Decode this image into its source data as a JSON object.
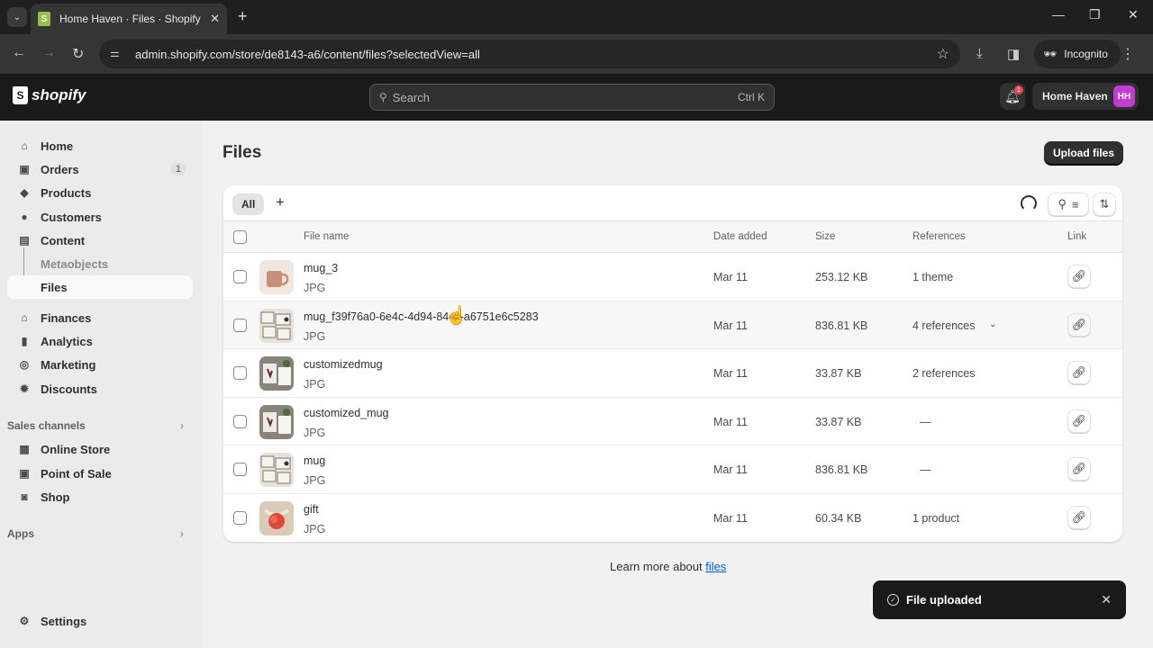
{
  "browser": {
    "tab_title": "Home Haven · Files · Shopify",
    "url": "admin.shopify.com/store/de8143-a6/content/files?selectedView=all",
    "incognito_label": "Incognito"
  },
  "topbar": {
    "logo_text": "shopify",
    "search_placeholder": "Search",
    "search_shortcut": "Ctrl K",
    "notification_count": "1",
    "store_name": "Home Haven",
    "avatar_initials": "HH",
    "avatar_color": "#c43bd4"
  },
  "sidebar": {
    "items": [
      {
        "label": "Home",
        "icon": "home-icon"
      },
      {
        "label": "Orders",
        "icon": "orders-icon",
        "count": "1"
      },
      {
        "label": "Products",
        "icon": "tag-icon"
      },
      {
        "label": "Customers",
        "icon": "person-icon"
      },
      {
        "label": "Content",
        "icon": "content-icon"
      },
      {
        "label": "Metaobjects"
      },
      {
        "label": "Files"
      },
      {
        "label": "Finances",
        "icon": "bank-icon"
      },
      {
        "label": "Analytics",
        "icon": "bar-chart-icon"
      },
      {
        "label": "Marketing",
        "icon": "target-icon"
      },
      {
        "label": "Discounts",
        "icon": "discount-icon"
      }
    ],
    "sales_channels_label": "Sales channels",
    "sales_channels": [
      {
        "label": "Online Store",
        "icon": "store-icon"
      },
      {
        "label": "Point of Sale",
        "icon": "pos-icon"
      },
      {
        "label": "Shop",
        "icon": "shop-icon"
      }
    ],
    "apps_label": "Apps",
    "settings_label": "Settings"
  },
  "main": {
    "title": "Files",
    "upload_label": "Upload files",
    "view_tab": "All",
    "columns": {
      "file_name": "File name",
      "date_added": "Date added",
      "size": "Size",
      "references": "References",
      "link": "Link"
    },
    "rows": [
      {
        "name": "mug_3",
        "type": "JPG",
        "date": "Mar 11",
        "size": "253.12 KB",
        "refs": "1 theme"
      },
      {
        "name": "mug_f39f76a0-6e4c-4d94-84cc-a6751e6c5283",
        "type": "JPG",
        "date": "Mar 11",
        "size": "836.81 KB",
        "refs": "4 references"
      },
      {
        "name": "customizedmug",
        "type": "JPG",
        "date": "Mar 11",
        "size": "33.87 KB",
        "refs": "2 references"
      },
      {
        "name": "customized_mug",
        "type": "JPG",
        "date": "Mar 11",
        "size": "33.87 KB",
        "refs": "—"
      },
      {
        "name": "mug",
        "type": "JPG",
        "date": "Mar 11",
        "size": "836.81 KB",
        "refs": "—"
      },
      {
        "name": "gift",
        "type": "JPG",
        "date": "Mar 11",
        "size": "60.34 KB",
        "refs": "1 product"
      }
    ],
    "learn_prefix": "Learn more about ",
    "learn_link": "files"
  },
  "toast": {
    "message": "File uploaded"
  }
}
